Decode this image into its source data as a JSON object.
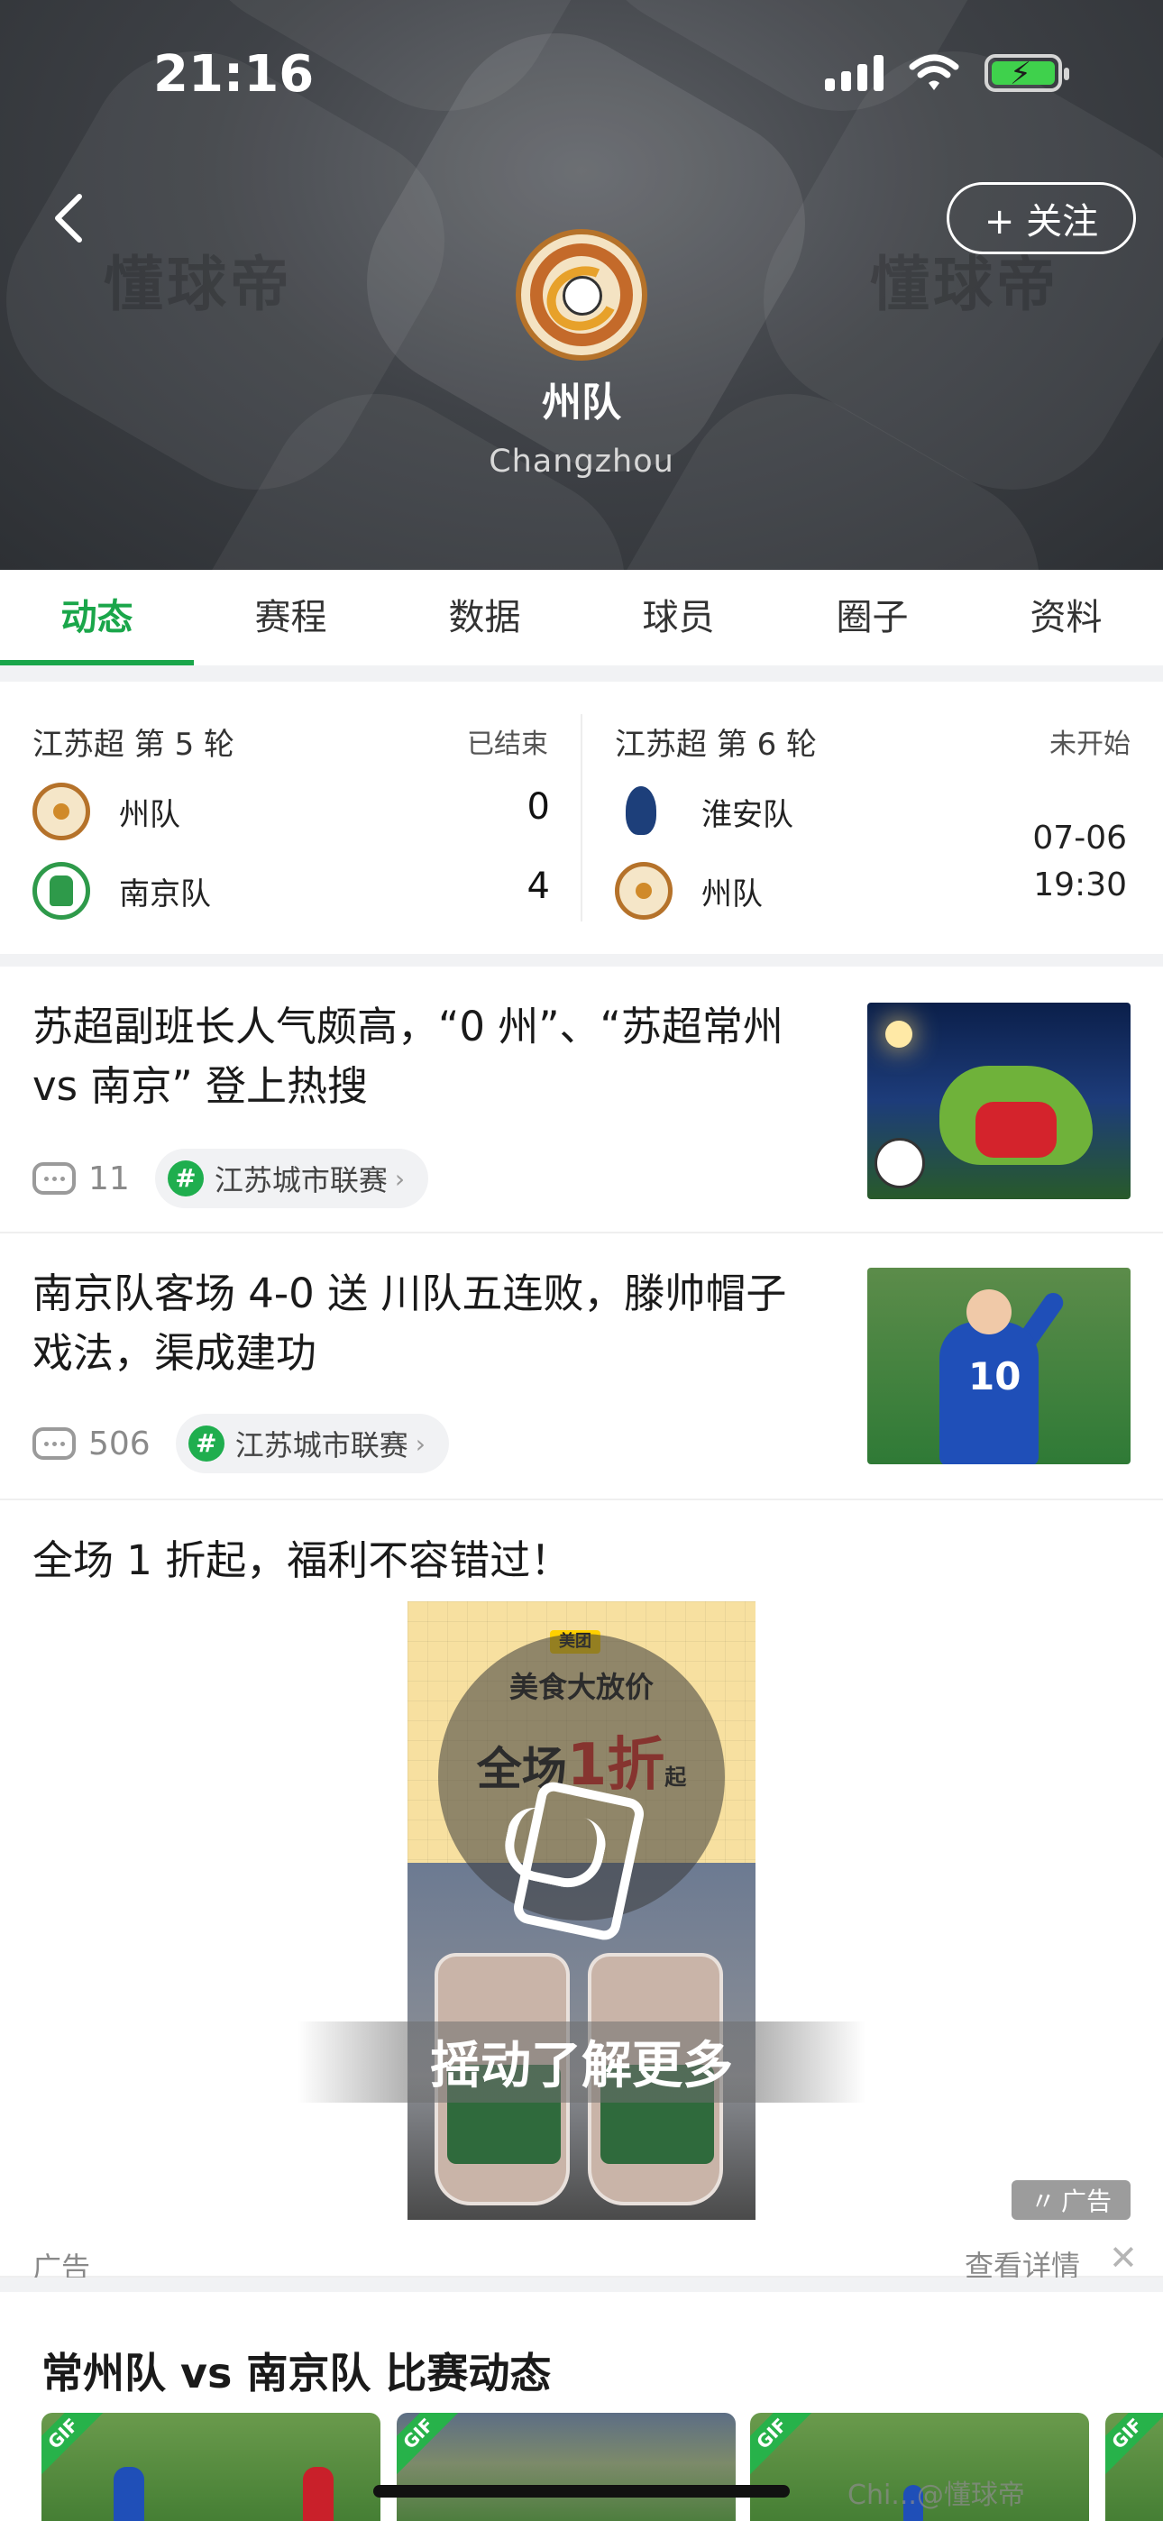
{
  "status_bar": {
    "time": "21:16"
  },
  "header": {
    "watermark": "懂球帝",
    "follow_label": "+ 关注",
    "team_name": "州队",
    "team_name_en": "Changzhou"
  },
  "tabs": [
    "动态",
    "赛程",
    "数据",
    "球员",
    "圈子",
    "资料"
  ],
  "active_tab": "动态",
  "matches": [
    {
      "league": "江苏超 第 5 轮",
      "status": "已结束",
      "home": {
        "name": "州队",
        "score": "0"
      },
      "away": {
        "name": "南京队",
        "score": "4"
      }
    },
    {
      "league": "江苏超 第 6 轮",
      "status": "未开始",
      "home": {
        "name": "淮安队"
      },
      "away": {
        "name": "州队"
      },
      "date": "07-06",
      "time": "19:30"
    }
  ],
  "news": [
    {
      "title": "苏超副班长人气颇高，“0 州”、“苏超常州 vs 南京” 登上热搜",
      "comments": "11",
      "tag": "江苏城市联赛"
    },
    {
      "title": "南京队客场 4-0 送  川队五连败，滕帅帽子戏法，渠成建功",
      "comments": "506",
      "tag": "江苏城市联赛"
    }
  ],
  "ad": {
    "title": "全场 1 折起，福利不容错过！",
    "brand": "美团",
    "headline": "美食大放价",
    "promo_prefix": "全场",
    "promo_value": "1折",
    "promo_suffix": "起",
    "shake_text": "摇动了解更多",
    "badge": "广告",
    "label": "广告",
    "detail": "查看详情",
    "close": "✕"
  },
  "highlights": {
    "title": "常州队 vs 南京队 比赛动态",
    "gif_label": "GIF"
  },
  "corner_watermark": "Chi...@懂球帝"
}
